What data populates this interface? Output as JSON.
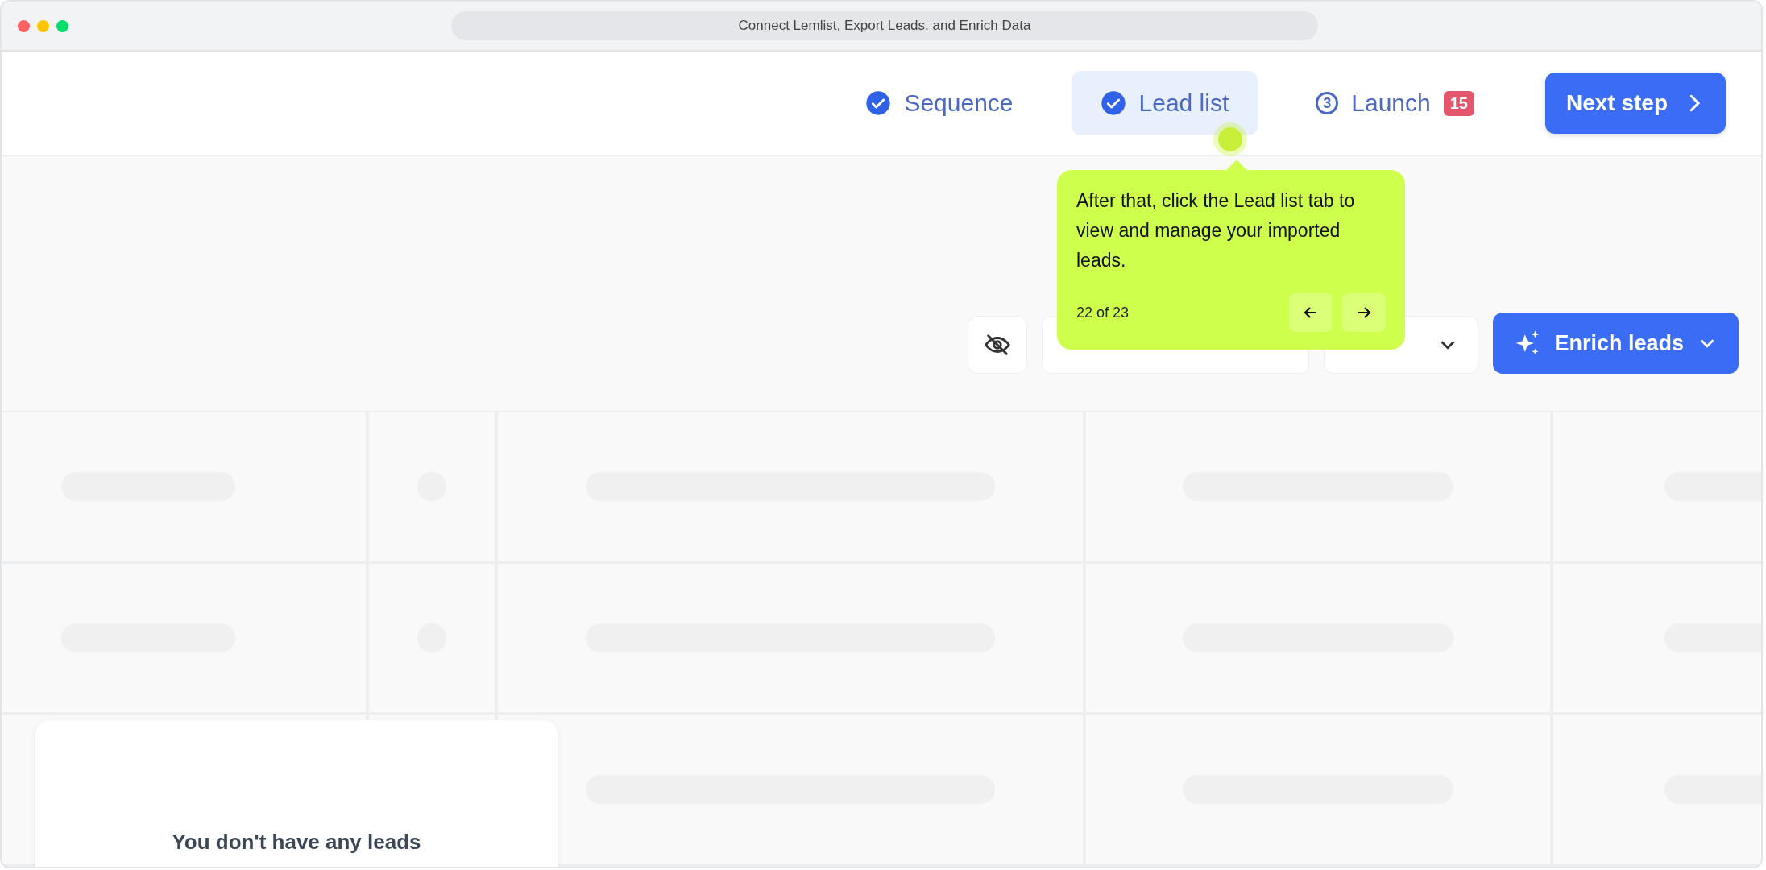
{
  "window": {
    "title": "Connect Lemlist, Export Leads, and Enrich Data"
  },
  "steps": [
    {
      "label": "Sequence",
      "kind": "done",
      "selected": false
    },
    {
      "label": "Lead list",
      "kind": "done",
      "selected": true
    },
    {
      "label": "Launch",
      "kind": "numbered",
      "number": "3",
      "badge": "15",
      "selected": false
    }
  ],
  "next_button": "Next step",
  "toolbar": {
    "enrich": "Enrich leads"
  },
  "tooltip": {
    "text": "After that, click the Lead list tab to view and manage your imported leads.",
    "counter": "22 of 23"
  },
  "empty_state": {
    "title": "You don't have any leads"
  }
}
